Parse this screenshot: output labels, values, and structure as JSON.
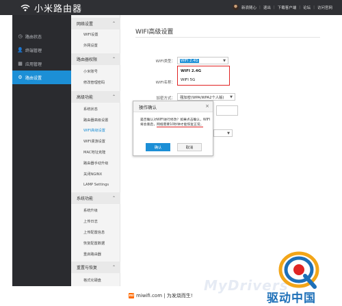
{
  "app": {
    "title": "小米路由器",
    "user_name": "新浪随心",
    "links": [
      "退出",
      "下载客户端",
      "论坛",
      "访问官网"
    ]
  },
  "sidebar": {
    "items": [
      {
        "label": "路由状态",
        "icon": "clock-icon"
      },
      {
        "label": "终端管理",
        "icon": "user-icon"
      },
      {
        "label": "应用管理",
        "icon": "grid-icon"
      },
      {
        "label": "路由设置",
        "icon": "gear-icon",
        "active": true
      }
    ]
  },
  "submenu": {
    "groups": [
      {
        "header": "网络设置",
        "items": [
          "WIFI设置",
          "外网设置"
        ]
      },
      {
        "header": "路由器权限",
        "items": [
          "小米账号",
          "修改管理密码"
        ]
      },
      {
        "header": "高级功能",
        "items": [
          "系统状态",
          "路由器高级设置",
          "WIFI高级设置",
          "WIFI漫游设置",
          "MAC地址克隆",
          "路由器手动升级",
          "关闭NGINX",
          "LAMP Settings"
        ]
      },
      {
        "header": "系统功能",
        "items": [
          "系统升级",
          "上传日志",
          "上传配置信息",
          "恢复配置数据",
          "重启路由器"
        ]
      },
      {
        "header": "重置与恢复",
        "items": [
          "格式化硬盘"
        ]
      }
    ],
    "active_item": "WIFI高级设置"
  },
  "main": {
    "title": "WIFI高级设置",
    "wifi_type_label": "WIFI类型：",
    "wifi_type_value": "WIFI 2.4G",
    "wifi_name_label": "WIFI名称：",
    "encryption_label": "加密方式：",
    "encryption_value": "强加密(WPA/WPA2个人版)",
    "dropdown_options": [
      "WIFI 2.4G",
      "WIFI 5G"
    ]
  },
  "modal": {
    "title": "操作确认",
    "close_symbol": "×",
    "message_part1": "是否确认对WIFI进行修改？如果点击确认，WIFI将会重启，",
    "message_underlined": "网络需要10秒钟才能恢复正常。",
    "confirm_label": "确认",
    "cancel_label": "取消"
  },
  "footer": {
    "logo_letter": "mi",
    "site": "miwifi.com",
    "slogan": "为发烧而生!"
  },
  "watermark": {
    "text": "MyDrivers",
    "brand_cn": "驱动中国"
  },
  "colors": {
    "topbar": "#2f3034",
    "sidebar": "#2a2b2f",
    "accent": "#1c8fd6",
    "highlight_red": "#e02020",
    "mi_orange": "#ff6a00"
  }
}
